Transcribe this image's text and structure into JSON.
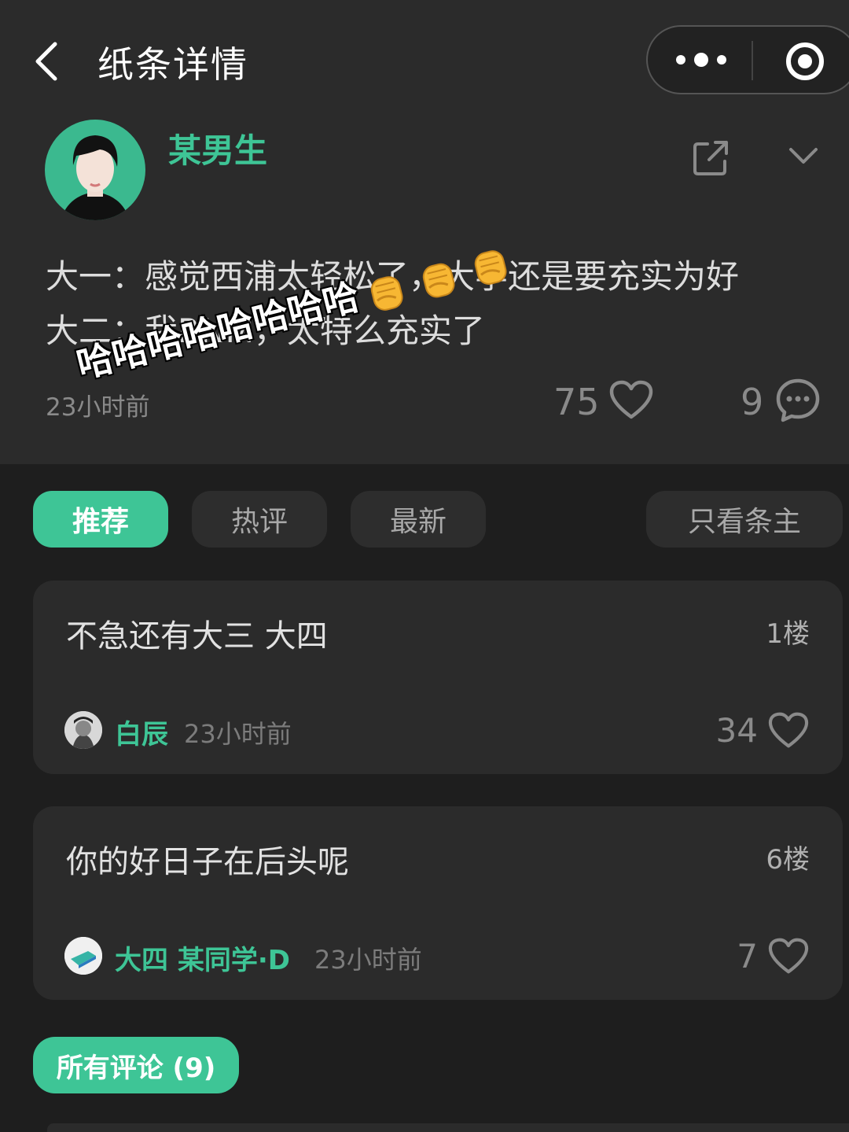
{
  "header": {
    "title": "纸条详情"
  },
  "post": {
    "author": "某男生",
    "lines": [
      "大一：感觉西浦太轻松了，大学还是要充实为好",
      "大二：我RNM，太特么充实了"
    ],
    "time": "23小时前",
    "likes": "75",
    "comments": "9"
  },
  "overlay_text": "哈哈哈哈哈哈哈哈",
  "tabs": [
    {
      "label": "推荐",
      "active": true
    },
    {
      "label": "热评",
      "active": false
    },
    {
      "label": "最新",
      "active": false
    },
    {
      "label": "只看条主",
      "active": false
    }
  ],
  "comments": [
    {
      "text": "不急还有大三 大四",
      "floor": "1楼",
      "name": "白辰",
      "time": "23小时前",
      "likes": "34"
    },
    {
      "text": "你的好日子在后头呢",
      "floor": "6楼",
      "name": "大四 某同学·D",
      "time": "23小时前",
      "likes": "7"
    }
  ],
  "all_comments_button": "所有评论 (9)",
  "colors": {
    "accent": "#3ec596",
    "background": "#1e1e1e",
    "panel": "#2b2b2b"
  }
}
